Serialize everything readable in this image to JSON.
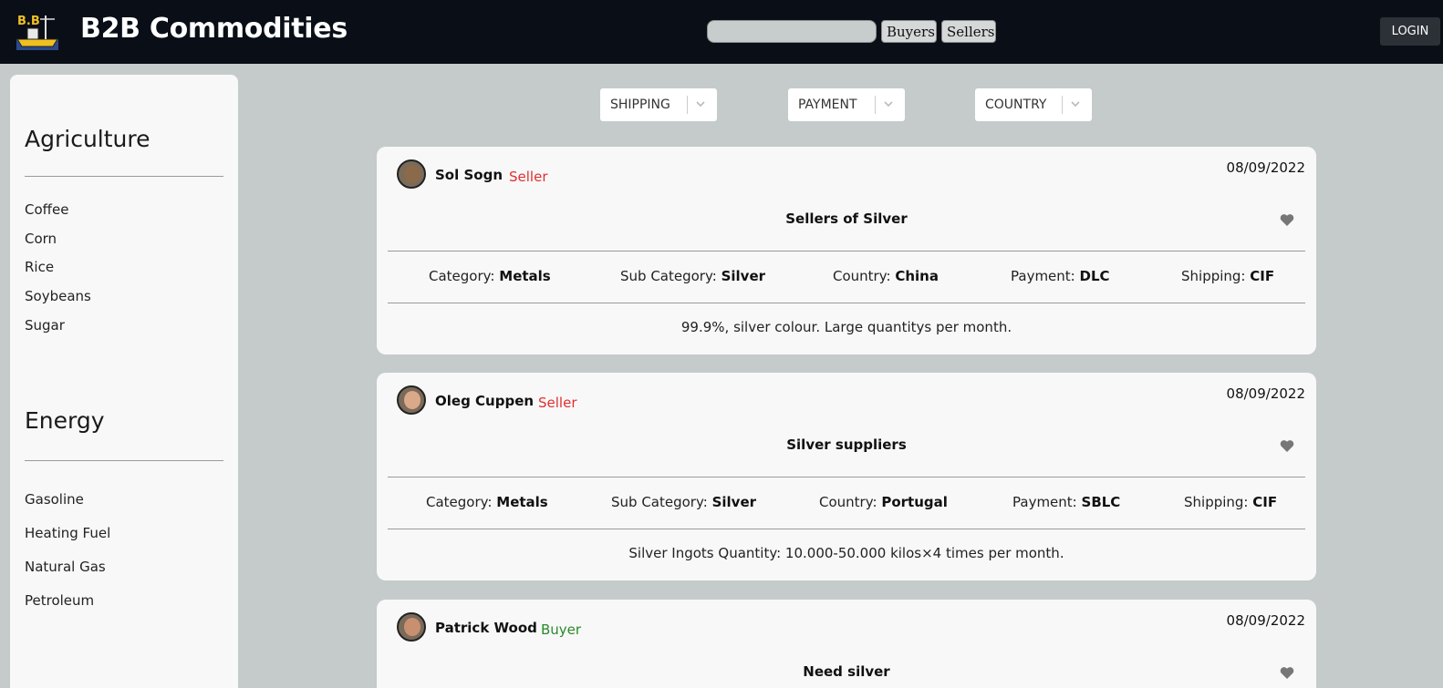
{
  "header": {
    "brand": "B2B Commodities",
    "search_value": "",
    "buyers_label": "Buyers",
    "sellers_label": "Sellers",
    "login_label": "LOGIN"
  },
  "sidebar": {
    "sections": [
      {
        "title": "Agriculture",
        "items": [
          "Coffee",
          "Corn",
          "Rice",
          "Soybeans",
          "Sugar"
        ]
      },
      {
        "title": "Energy",
        "items": [
          "Gasoline",
          "Heating Fuel",
          "Natural Gas",
          "Petroleum"
        ]
      }
    ]
  },
  "filters": {
    "shipping": "SHIPPING",
    "payment": "PAYMENT",
    "country": "COUNTRY"
  },
  "field_labels": {
    "category": "Category:",
    "sub_category": "Sub Category:",
    "country": "Country:",
    "payment": "Payment:",
    "shipping": "Shipping:"
  },
  "colors": {
    "seller": "#e03030",
    "buyer": "#2a8a2a",
    "header_bg": "#0a0e17",
    "page_bg": "#c5cbcb"
  },
  "listings": [
    {
      "user": "Sol Sogn",
      "role": "Seller",
      "date": "08/09/2022",
      "title": "Sellers of Silver",
      "category": "Metals",
      "sub_category": "Silver",
      "country": "China",
      "payment": "DLC",
      "shipping": "CIF",
      "description": "99.9%, silver colour. Large quantitys per month."
    },
    {
      "user": "Oleg Cuppen",
      "role": "Seller",
      "date": "08/09/2022",
      "title": "Silver suppliers",
      "category": "Metals",
      "sub_category": "Silver",
      "country": "Portugal",
      "payment": "SBLC",
      "shipping": "CIF",
      "description": "Silver Ingots Quantity: 10.000-50.000 kilos×4 times per month."
    },
    {
      "user": "Patrick Wood",
      "role": "Buyer",
      "date": "08/09/2022",
      "title": "Need silver"
    }
  ]
}
